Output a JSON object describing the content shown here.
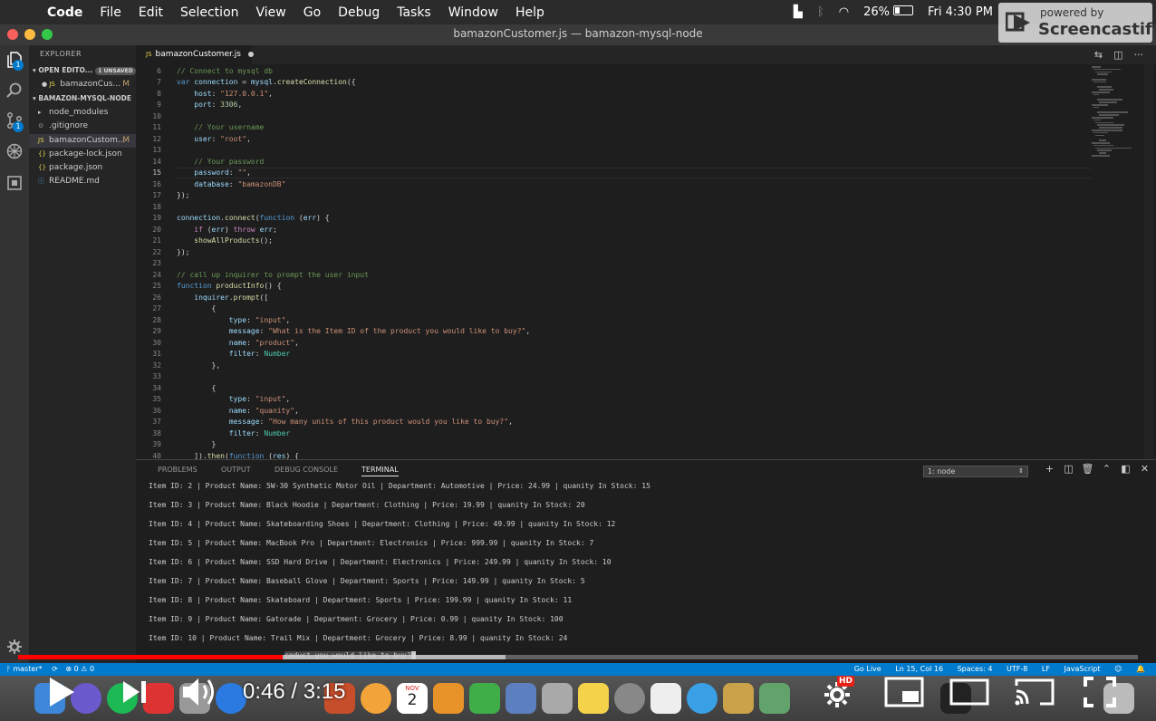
{
  "menubar": {
    "items": [
      "Code",
      "File",
      "Edit",
      "Selection",
      "View",
      "Go",
      "Debug",
      "Tasks",
      "Window",
      "Help"
    ],
    "battery": "26%",
    "clock": "Fri 4:30 PM"
  },
  "watermark": {
    "top": "powered by",
    "brand": "Screencastify"
  },
  "window": {
    "title": "bamazonCustomer.js — bamazon-mysql-node"
  },
  "sidebar": {
    "title": "EXPLORER",
    "open_editors_label": "OPEN EDITO...",
    "unsaved_badge": "1 UNSAVED",
    "open_editors": [
      {
        "icon": "JS",
        "label": "bamazonCus...",
        "status": "M"
      }
    ],
    "project_label": "BAMAZON-MYSQL-NODE",
    "files": [
      {
        "icon": "▸",
        "label": "node_modules",
        "status": ""
      },
      {
        "icon": "⚙",
        "label": ".gitignore",
        "status": ""
      },
      {
        "icon": "JS",
        "label": "bamazonCustom...",
        "status": "M"
      },
      {
        "icon": "{}",
        "label": "package-lock.json",
        "status": ""
      },
      {
        "icon": "{}",
        "label": "package.json",
        "status": ""
      },
      {
        "icon": "ⓘ",
        "label": "README.md",
        "status": ""
      }
    ]
  },
  "editor": {
    "tab": {
      "icon": "JS",
      "label": "bamazonCustomer.js"
    },
    "lines": [
      {
        "n": "6",
        "t": [
          [
            "c-com",
            "// Connect to mysql db"
          ]
        ]
      },
      {
        "n": "7",
        "t": [
          [
            "c-kw",
            "var "
          ],
          [
            "c-var",
            "connection"
          ],
          [
            "c-pl",
            " = "
          ],
          [
            "c-var",
            "mysql"
          ],
          [
            "c-pl",
            "."
          ],
          [
            "c-fn",
            "createConnection"
          ],
          [
            "c-pl",
            "({"
          ]
        ]
      },
      {
        "n": "8",
        "t": [
          [
            "c-pl",
            "    "
          ],
          [
            "c-var",
            "host"
          ],
          [
            "c-pl",
            ": "
          ],
          [
            "c-str",
            "\"127.0.0.1\""
          ],
          [
            "c-pl",
            ","
          ]
        ]
      },
      {
        "n": "9",
        "t": [
          [
            "c-pl",
            "    "
          ],
          [
            "c-var",
            "port"
          ],
          [
            "c-pl",
            ": "
          ],
          [
            "c-num",
            "3306"
          ],
          [
            "c-pl",
            ","
          ]
        ]
      },
      {
        "n": "10",
        "t": []
      },
      {
        "n": "11",
        "t": [
          [
            "c-pl",
            "    "
          ],
          [
            "c-com",
            "// Your username"
          ]
        ]
      },
      {
        "n": "12",
        "t": [
          [
            "c-pl",
            "    "
          ],
          [
            "c-var",
            "user"
          ],
          [
            "c-pl",
            ": "
          ],
          [
            "c-str",
            "\"root\""
          ],
          [
            "c-pl",
            ","
          ]
        ]
      },
      {
        "n": "13",
        "t": []
      },
      {
        "n": "14",
        "t": [
          [
            "c-pl",
            "    "
          ],
          [
            "c-com",
            "// Your password"
          ]
        ]
      },
      {
        "n": "15",
        "t": [
          [
            "c-pl",
            "    "
          ],
          [
            "c-var",
            "password"
          ],
          [
            "c-pl",
            ": "
          ],
          [
            "c-str",
            "\"\""
          ],
          [
            "c-pl",
            ","
          ]
        ]
      },
      {
        "n": "16",
        "t": [
          [
            "c-pl",
            "    "
          ],
          [
            "c-var",
            "database"
          ],
          [
            "c-pl",
            ": "
          ],
          [
            "c-str",
            "\"bamazonDB\""
          ]
        ]
      },
      {
        "n": "17",
        "t": [
          [
            "c-pl",
            "});"
          ]
        ]
      },
      {
        "n": "18",
        "t": []
      },
      {
        "n": "19",
        "t": [
          [
            "c-var",
            "connection"
          ],
          [
            "c-pl",
            "."
          ],
          [
            "c-fn",
            "connect"
          ],
          [
            "c-pl",
            "("
          ],
          [
            "c-kw",
            "function"
          ],
          [
            "c-pl",
            " ("
          ],
          [
            "c-var",
            "err"
          ],
          [
            "c-pl",
            ") {"
          ]
        ]
      },
      {
        "n": "20",
        "t": [
          [
            "c-pl",
            "    "
          ],
          [
            "c-ctl",
            "if"
          ],
          [
            "c-pl",
            " ("
          ],
          [
            "c-var",
            "err"
          ],
          [
            "c-pl",
            ") "
          ],
          [
            "c-ctl",
            "throw"
          ],
          [
            "c-pl",
            " "
          ],
          [
            "c-var",
            "err"
          ],
          [
            "c-pl",
            ";"
          ]
        ]
      },
      {
        "n": "21",
        "t": [
          [
            "c-pl",
            "    "
          ],
          [
            "c-fn",
            "showAllProducts"
          ],
          [
            "c-pl",
            "();"
          ]
        ]
      },
      {
        "n": "22",
        "t": [
          [
            "c-pl",
            "});"
          ]
        ]
      },
      {
        "n": "23",
        "t": []
      },
      {
        "n": "24",
        "t": [
          [
            "c-com",
            "// call up inquirer to prompt the user input"
          ]
        ]
      },
      {
        "n": "25",
        "t": [
          [
            "c-kw",
            "function "
          ],
          [
            "c-fn",
            "productInfo"
          ],
          [
            "c-pl",
            "() {"
          ]
        ]
      },
      {
        "n": "26",
        "t": [
          [
            "c-pl",
            "    "
          ],
          [
            "c-var",
            "inquirer"
          ],
          [
            "c-pl",
            "."
          ],
          [
            "c-fn",
            "prompt"
          ],
          [
            "c-pl",
            "(["
          ]
        ]
      },
      {
        "n": "27",
        "t": [
          [
            "c-pl",
            "        {"
          ]
        ]
      },
      {
        "n": "28",
        "t": [
          [
            "c-pl",
            "            "
          ],
          [
            "c-var",
            "type"
          ],
          [
            "c-pl",
            ": "
          ],
          [
            "c-str",
            "\"input\""
          ],
          [
            "c-pl",
            ","
          ]
        ]
      },
      {
        "n": "29",
        "t": [
          [
            "c-pl",
            "            "
          ],
          [
            "c-var",
            "message"
          ],
          [
            "c-pl",
            ": "
          ],
          [
            "c-str",
            "\"What is the Item ID of the product you would like to buy?\""
          ],
          [
            "c-pl",
            ","
          ]
        ]
      },
      {
        "n": "30",
        "t": [
          [
            "c-pl",
            "            "
          ],
          [
            "c-var",
            "name"
          ],
          [
            "c-pl",
            ": "
          ],
          [
            "c-str",
            "\"product\""
          ],
          [
            "c-pl",
            ","
          ]
        ]
      },
      {
        "n": "31",
        "t": [
          [
            "c-pl",
            "            "
          ],
          [
            "c-var",
            "filter"
          ],
          [
            "c-pl",
            ": "
          ],
          [
            "c-ty",
            "Number"
          ]
        ]
      },
      {
        "n": "32",
        "t": [
          [
            "c-pl",
            "        },"
          ]
        ]
      },
      {
        "n": "33",
        "t": []
      },
      {
        "n": "34",
        "t": [
          [
            "c-pl",
            "        {"
          ]
        ]
      },
      {
        "n": "35",
        "t": [
          [
            "c-pl",
            "            "
          ],
          [
            "c-var",
            "type"
          ],
          [
            "c-pl",
            ": "
          ],
          [
            "c-str",
            "\"input\""
          ],
          [
            "c-pl",
            ","
          ]
        ]
      },
      {
        "n": "36",
        "t": [
          [
            "c-pl",
            "            "
          ],
          [
            "c-var",
            "name"
          ],
          [
            "c-pl",
            ": "
          ],
          [
            "c-str",
            "\"quanity\""
          ],
          [
            "c-pl",
            ","
          ]
        ]
      },
      {
        "n": "37",
        "t": [
          [
            "c-pl",
            "            "
          ],
          [
            "c-var",
            "message"
          ],
          [
            "c-pl",
            ": "
          ],
          [
            "c-str",
            "\"How many units of this product would you like to buy?\""
          ],
          [
            "c-pl",
            ","
          ]
        ]
      },
      {
        "n": "38",
        "t": [
          [
            "c-pl",
            "            "
          ],
          [
            "c-var",
            "filter"
          ],
          [
            "c-pl",
            ": "
          ],
          [
            "c-ty",
            "Number"
          ]
        ]
      },
      {
        "n": "39",
        "t": [
          [
            "c-pl",
            "        }"
          ]
        ]
      },
      {
        "n": "40",
        "t": [
          [
            "c-pl",
            "    ])."
          ],
          [
            "c-fn",
            "then"
          ],
          [
            "c-pl",
            "("
          ],
          [
            "c-kw",
            "function"
          ],
          [
            "c-pl",
            " ("
          ],
          [
            "c-var",
            "res"
          ],
          [
            "c-pl",
            ") {"
          ]
        ]
      }
    ]
  },
  "panel": {
    "tabs": [
      "PROBLEMS",
      "OUTPUT",
      "DEBUG CONSOLE",
      "TERMINAL"
    ],
    "terminal_select": "1: node",
    "terminal_lines": [
      "Item ID: 2 | Product Name: 5W-30 Synthetic Motor Oil | Department: Automotive | Price: 24.99 | quanity In Stock: 15",
      "Item ID: 3 | Product Name: Black Hoodie | Department: Clothing | Price: 19.99 | quanity In Stock: 20",
      "Item ID: 4 | Product Name: Skateboarding Shoes | Department: Clothing | Price: 49.99 | quanity In Stock: 12",
      "Item ID: 5 | Product Name: MacBook Pro | Department: Electronics | Price: 999.99 | quanity In Stock: 7",
      "Item ID: 6 | Product Name: SSD Hard Drive | Department: Electronics | Price: 249.99 | quanity In Stock: 10",
      "Item ID: 7 | Product Name: Baseball Glove | Department: Sports | Price: 149.99 | quanity In Stock: 5",
      "Item ID: 8 | Product Name: Skateboard | Department: Sports | Price: 199.99 | quanity In Stock: 11",
      "Item ID: 9 | Product Name: Gatorade | Department: Grocery | Price: 0.99 | quanity In Stock: 100",
      "Item ID: 10 | Product Name: Trail Mix | Department: Grocery | Price: 8.99 | quanity In Stock: 24"
    ],
    "prompt_tail": "roduct you would like to buy?"
  },
  "statusbar": {
    "branch": "master*",
    "sync": "⟳",
    "problems": "⊗ 0 ⚠ 0",
    "golive": "Go Live",
    "position": "Ln 15, Col 16",
    "spaces": "Spaces: 4",
    "encoding": "UTF-8",
    "eol": "LF",
    "language": "JavaScript"
  },
  "dock": {
    "calendar_month": "NOV",
    "calendar_day": "2"
  },
  "video": {
    "current": "0:46",
    "duration": "3:15",
    "hd_badge": "HD",
    "played_fraction": 0.236,
    "buffered_fraction": 0.435
  }
}
